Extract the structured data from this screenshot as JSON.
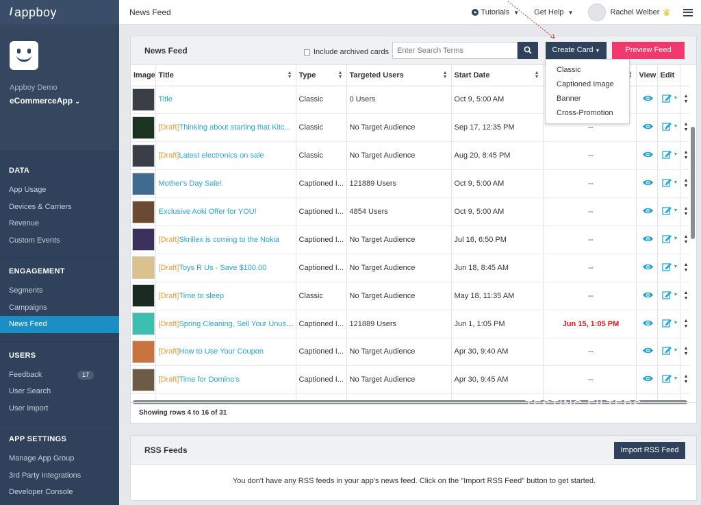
{
  "brand": {
    "name": "appboy"
  },
  "app": {
    "label": "Appboy Demo",
    "name": "eCommerceApp"
  },
  "nav": {
    "data_head": "DATA",
    "data_items": [
      "App Usage",
      "Devices & Carriers",
      "Revenue",
      "Custom Events"
    ],
    "engagement_head": "ENGAGEMENT",
    "engagement_items": [
      "Segments",
      "Campaigns",
      "News Feed"
    ],
    "users_head": "USERS",
    "users_items": [
      "Feedback",
      "User Search",
      "User Import"
    ],
    "feedback_count": "17",
    "settings_head": "APP SETTINGS",
    "settings_items": [
      "Manage App Group",
      "3rd Party Integrations",
      "Developer Console"
    ]
  },
  "topbar": {
    "title": "News Feed",
    "tutorials": "Tutorials",
    "help": "Get Help",
    "user": "Rachel Welber"
  },
  "feed": {
    "title": "News Feed",
    "archived_label": "Include archived cards",
    "search_placeholder": "Enter Search Terms",
    "create_label": "Create Card",
    "preview_label": "Preview Feed",
    "footer": "Showing rows 4 to 16 of 31",
    "overlay": "TESTING FILTERS",
    "columns": [
      "Image",
      "Title",
      "Type",
      "Targeted Users",
      "Start Date",
      "",
      "View",
      "Edit"
    ],
    "dropdown": [
      "Classic",
      "Captioned Image",
      "Banner",
      "Cross-Promotion"
    ],
    "rows": [
      {
        "draft": "",
        "title": "Title",
        "type": "Classic",
        "users": "0 Users",
        "start": "Oct 9, 5:00 AM",
        "end": "",
        "thumb": "#3a3f47"
      },
      {
        "draft": "[Draft]",
        "title": "Thinking about starting that Kitc...",
        "type": "Classic",
        "users": "No Target Audience",
        "start": "Sep 17, 12:35 PM",
        "end": "--",
        "thumb": "#1d3322"
      },
      {
        "draft": "[Draft]",
        "title": "Latest electronics on sale",
        "type": "Classic",
        "users": "No Target Audience",
        "start": "Aug 20, 8:45 PM",
        "end": "--",
        "thumb": "#3a3f47"
      },
      {
        "draft": "",
        "title": "Mother's Day Sale!",
        "type": "Captioned I...",
        "users": "121889 Users",
        "start": "Oct 9, 5:00 AM",
        "end": "--",
        "thumb": "#3f6b8f"
      },
      {
        "draft": "",
        "title": "Exclusive Aoki Offer for YOU!",
        "type": "Captioned I...",
        "users": "4854 Users",
        "start": "Oct 9, 5:00 AM",
        "end": "--",
        "thumb": "#6b4a33"
      },
      {
        "draft": "[Draft]",
        "title": "Skrillex is coming to the Nokia",
        "type": "Captioned I...",
        "users": "No Target Audience",
        "start": "Jul 16, 6:50 PM",
        "end": "--",
        "thumb": "#3b2f5c"
      },
      {
        "draft": "[Draft]",
        "title": "Toys R Us - Save $100.00",
        "type": "Captioned I...",
        "users": "No Target Audience",
        "start": "Jun 18, 8:45 AM",
        "end": "--",
        "thumb": "#d9c28e"
      },
      {
        "draft": "[Draft]",
        "title": "Time to sleep",
        "type": "Classic",
        "users": "No Target Audience",
        "start": "May 18, 11:35 AM",
        "end": "--",
        "thumb": "#1b2a22"
      },
      {
        "draft": "[Draft]",
        "title": "Spring Cleaning, Sell Your Unuse...",
        "type": "Captioned I...",
        "users": "121889 Users",
        "start": "Jun 1, 1:05 PM",
        "end": "Jun 15, 1:05 PM",
        "thumb": "#3cbfb0"
      },
      {
        "draft": "[Draft]",
        "title": "How to Use Your Coupon",
        "type": "Captioned I...",
        "users": "No Target Audience",
        "start": "Apr 30, 9:40 AM",
        "end": "--",
        "thumb": "#c9733e"
      },
      {
        "draft": "[Draft]",
        "title": "Time for Domino's",
        "type": "Captioned I...",
        "users": "No Target Audience",
        "start": "Apr 30, 9:45 AM",
        "end": "--",
        "thumb": "#6e5a45"
      },
      {
        "draft": "",
        "title": "",
        "type": "",
        "users": "",
        "start": "",
        "end": "",
        "thumb": "#ffffff"
      }
    ]
  },
  "rss": {
    "title": "RSS Feeds",
    "import_label": "Import RSS Feed",
    "empty_msg": "You don't have any RSS feeds in your app's news feed. Click on the \"Import RSS Feed\" button to get started."
  }
}
